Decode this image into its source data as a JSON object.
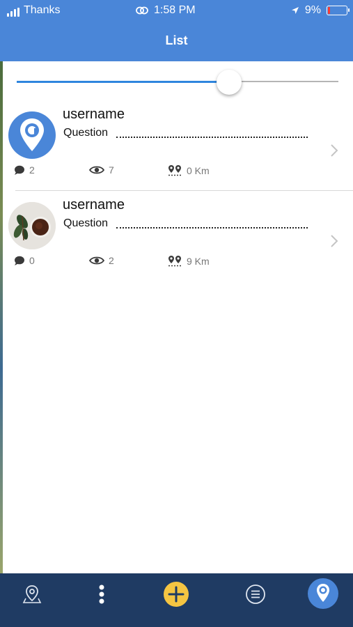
{
  "status_bar": {
    "carrier": "Thanks",
    "time": "1:58 PM",
    "battery_percent": "9%",
    "battery_color": "#ff3b30"
  },
  "header": {
    "title": "List",
    "background_color": "#4a86d8"
  },
  "distance_slider": {
    "value_fraction": 0.66,
    "fill_color": "#2f86de"
  },
  "list_items": [
    {
      "username": "username",
      "question": "Question",
      "comments": "2",
      "views": "7",
      "distance": "0 Km",
      "avatar": "app-pin-logo"
    },
    {
      "username": "username",
      "question": "Question",
      "comments": "0",
      "views": "2",
      "distance": "9 Km",
      "avatar": "coffee-photo"
    }
  ],
  "tab_bar": {
    "items": [
      "map-pin-icon",
      "more-vertical-icon",
      "add-icon",
      "list-icon",
      "app-logo-icon"
    ],
    "background_color": "#1f3b63",
    "add_color": "#f5c542"
  }
}
